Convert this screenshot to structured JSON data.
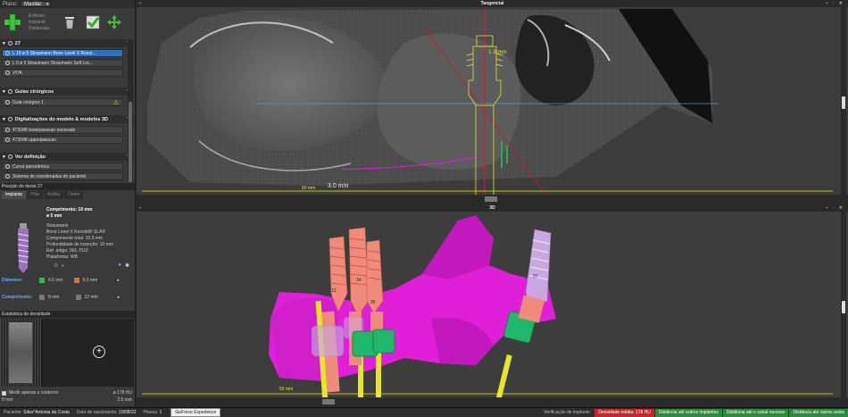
{
  "left": {
    "plano_label": "Plano:",
    "plano_value": "Maxilar",
    "tool_list": [
      "Esférico",
      "Implante",
      "Distâncias"
    ],
    "sections": [
      {
        "title": "27"
      },
      {
        "title": "Guias cirúrgicos"
      },
      {
        "title": "Digitalizações do modelo & modelos 3D"
      },
      {
        "title": "Ver definição"
      }
    ],
    "implant_rows": [
      "L 10 ø 5   Straumann Bone Level X Roxol...",
      "L 9 ø 5   Straumann Straumann Self Loc...",
      "VITA"
    ],
    "guide_row": "Guia cirúrgico 1",
    "scan_rows": [
      "473048 lowerjawscan encerado",
      "473048 upperjawscan"
    ],
    "view_rows": [
      "Curva panorâmica",
      "Sistema de coordenadas do paciente"
    ],
    "position_title": "Posição do dente 27",
    "tabs": [
      "Implante",
      "Pilar",
      "Anilha",
      "Dente"
    ],
    "implant_info": {
      "length": "Comprimento: 10 mm",
      "diameter": "ø 5 mm",
      "details": [
        "Straumann",
        "Bone Level X Roxolid® SLA®",
        "Comprimento total: 10,0 mm",
        "Profundidade de inserção: 10 mm",
        "Ref. artigo: 061.7510",
        "Plataforma: WB"
      ]
    },
    "diameter_row": {
      "label": "Diâmetro:",
      "min": "4.5 mm",
      "max": "5.5 mm"
    },
    "length_row": {
      "label": "Comprimento:",
      "min": "8 mm",
      "max": "12 mm"
    },
    "density_title": "Estatística de densidade",
    "density_checkbox": "Medir apenas o contorno",
    "density_value": "ø 178 HU",
    "scale_left": "0 mm",
    "scale_right": "2.5 mm"
  },
  "view2d": {
    "title": "Tangencial",
    "implant_label": "L 9 mm",
    "measure_label": "3.0 mm",
    "ruler_label": "50 mm"
  },
  "view3d": {
    "title": "3D",
    "ruler_label": "50 mm",
    "implant_numbers": [
      "13",
      "14",
      "26",
      "27"
    ]
  },
  "status": {
    "patient_label": "Paciente:",
    "patient": "Silva^Antonia da Costa",
    "dob_label": "Data de nascimento:",
    "dob": "19/08/22",
    "planos_label": "Planos:",
    "planos": "1",
    "gpu": "GeForce Experience",
    "verif_label": "Verificação de implante:",
    "density": "Densidade média: 178 HU",
    "dist1": "Distância até outros implantes",
    "dist2": "Distância até o canal nervoso",
    "dist3": "Distância até outros anéis"
  },
  "colors": {
    "selected_row": "#2f6fbf",
    "implant_salmon": "#f08a7a",
    "implant_lilac": "#c8a8e0",
    "bone_magenta": "#e020d8",
    "sleeve_green": "#1fb86a",
    "drill_yellow": "#e6e62a",
    "status_red": "#c0282d",
    "status_green": "#2b8a3e"
  }
}
